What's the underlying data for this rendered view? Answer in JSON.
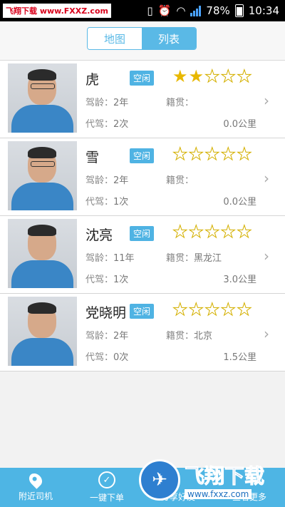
{
  "status_bar": {
    "watermark": "飞翔下载 www.FXXZ.com",
    "network": "3G",
    "battery": "78%",
    "time": "10:34"
  },
  "tabs": {
    "map": "地图",
    "list": "列表",
    "active": "列表"
  },
  "labels": {
    "age": "驾龄：",
    "origin": "籍贯：",
    "drives": "代驾："
  },
  "drivers": [
    {
      "name": "虎",
      "status": "空闲",
      "rating": 2,
      "age": "2年",
      "origin": "",
      "drives": "2次",
      "distance": "0.0公里"
    },
    {
      "name": "雪",
      "status": "空闲",
      "rating": 0,
      "age": "2年",
      "origin": "",
      "drives": "1次",
      "distance": "0.0公里"
    },
    {
      "name": "沈亮",
      "status": "空闲",
      "rating": 0,
      "age": "11年",
      "origin": "黑龙江",
      "drives": "1次",
      "distance": "3.0公里"
    },
    {
      "name": "党晓明",
      "status": "空闲",
      "rating": 0,
      "age": "2年",
      "origin": "北京",
      "drives": "0次",
      "distance": "1.5公里"
    }
  ],
  "bottom_nav": {
    "nearby": "附近司机",
    "order": "一键下单",
    "share": "分享好友",
    "more": "查看更多"
  },
  "overlay_watermark": {
    "title": "飞翔下载",
    "url": "www.fxxz.com"
  },
  "colors": {
    "accent": "#4eb5e4",
    "star": "#e8b800"
  }
}
